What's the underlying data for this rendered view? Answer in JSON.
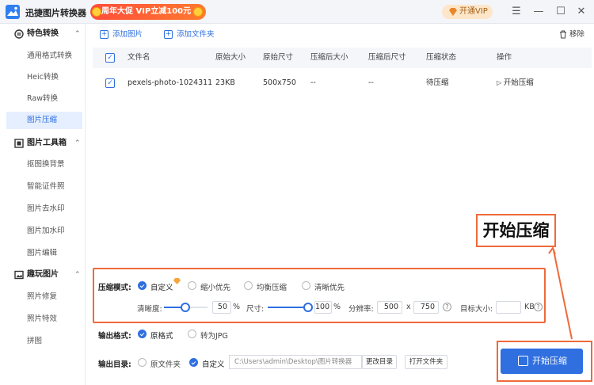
{
  "app": {
    "title": "迅捷图片转换器",
    "promo": "周年大促 VIP立减100元",
    "vip_button": "开通VIP"
  },
  "window_controls": {
    "menu": "☰",
    "minimize": "—",
    "maximize": "☐",
    "close": "✕"
  },
  "sidebar": {
    "sections": [
      {
        "title": "特色转换",
        "items": [
          "通用格式转换",
          "Heic转换",
          "Raw转换",
          "图片压缩"
        ]
      },
      {
        "title": "图片工具箱",
        "items": [
          "抠图换背景",
          "智能证件照",
          "图片去水印",
          "图片加水印",
          "图片编辑"
        ]
      },
      {
        "title": "趣玩图片",
        "items": [
          "照片修复",
          "照片特效",
          "拼图"
        ]
      }
    ],
    "active_item": "图片压缩"
  },
  "toolbar": {
    "add_image": "添加图片",
    "add_folder": "添加文件夹",
    "remove": "移除"
  },
  "table": {
    "headers": [
      "文件名",
      "原始大小",
      "原始尺寸",
      "压缩后大小",
      "压缩后尺寸",
      "压缩状态",
      "操作"
    ],
    "rows": [
      {
        "name": "pexels-photo-1024311",
        "size": "23KB",
        "dims": "500x750",
        "new_size": "--",
        "new_dims": "--",
        "status": "待压缩",
        "action": "开始压缩"
      }
    ]
  },
  "callout_text": "开始压缩",
  "compression": {
    "mode_label": "压缩模式:",
    "modes": [
      "自定义",
      "缩小优先",
      "均衡压缩",
      "清晰优先"
    ],
    "selected_mode": "自定义",
    "clarity_label": "清晰度:",
    "clarity_value": "50",
    "clarity_unit": "%",
    "size_label": "尺寸:",
    "size_value": "100",
    "size_unit": "%",
    "resolution_label": "分辨率:",
    "res_w": "500",
    "res_x": "x",
    "res_h": "750",
    "target_label": "目标大小:",
    "target_value": "",
    "target_unit": "KB"
  },
  "output_format": {
    "label": "输出格式:",
    "options": [
      "原格式",
      "转为JPG"
    ],
    "selected": "原格式"
  },
  "output_dir": {
    "label": "输出目录:",
    "options": [
      "原文件夹",
      "自定义"
    ],
    "selected": "自定义",
    "path": "C:\\Users\\admin\\Desktop\\图片转换器",
    "change_btn": "更改目录",
    "open_btn": "打开文件夹"
  },
  "start_button": "开始压缩",
  "colors": {
    "accent": "#2f6fe0",
    "highlight": "#ef6a3a"
  }
}
